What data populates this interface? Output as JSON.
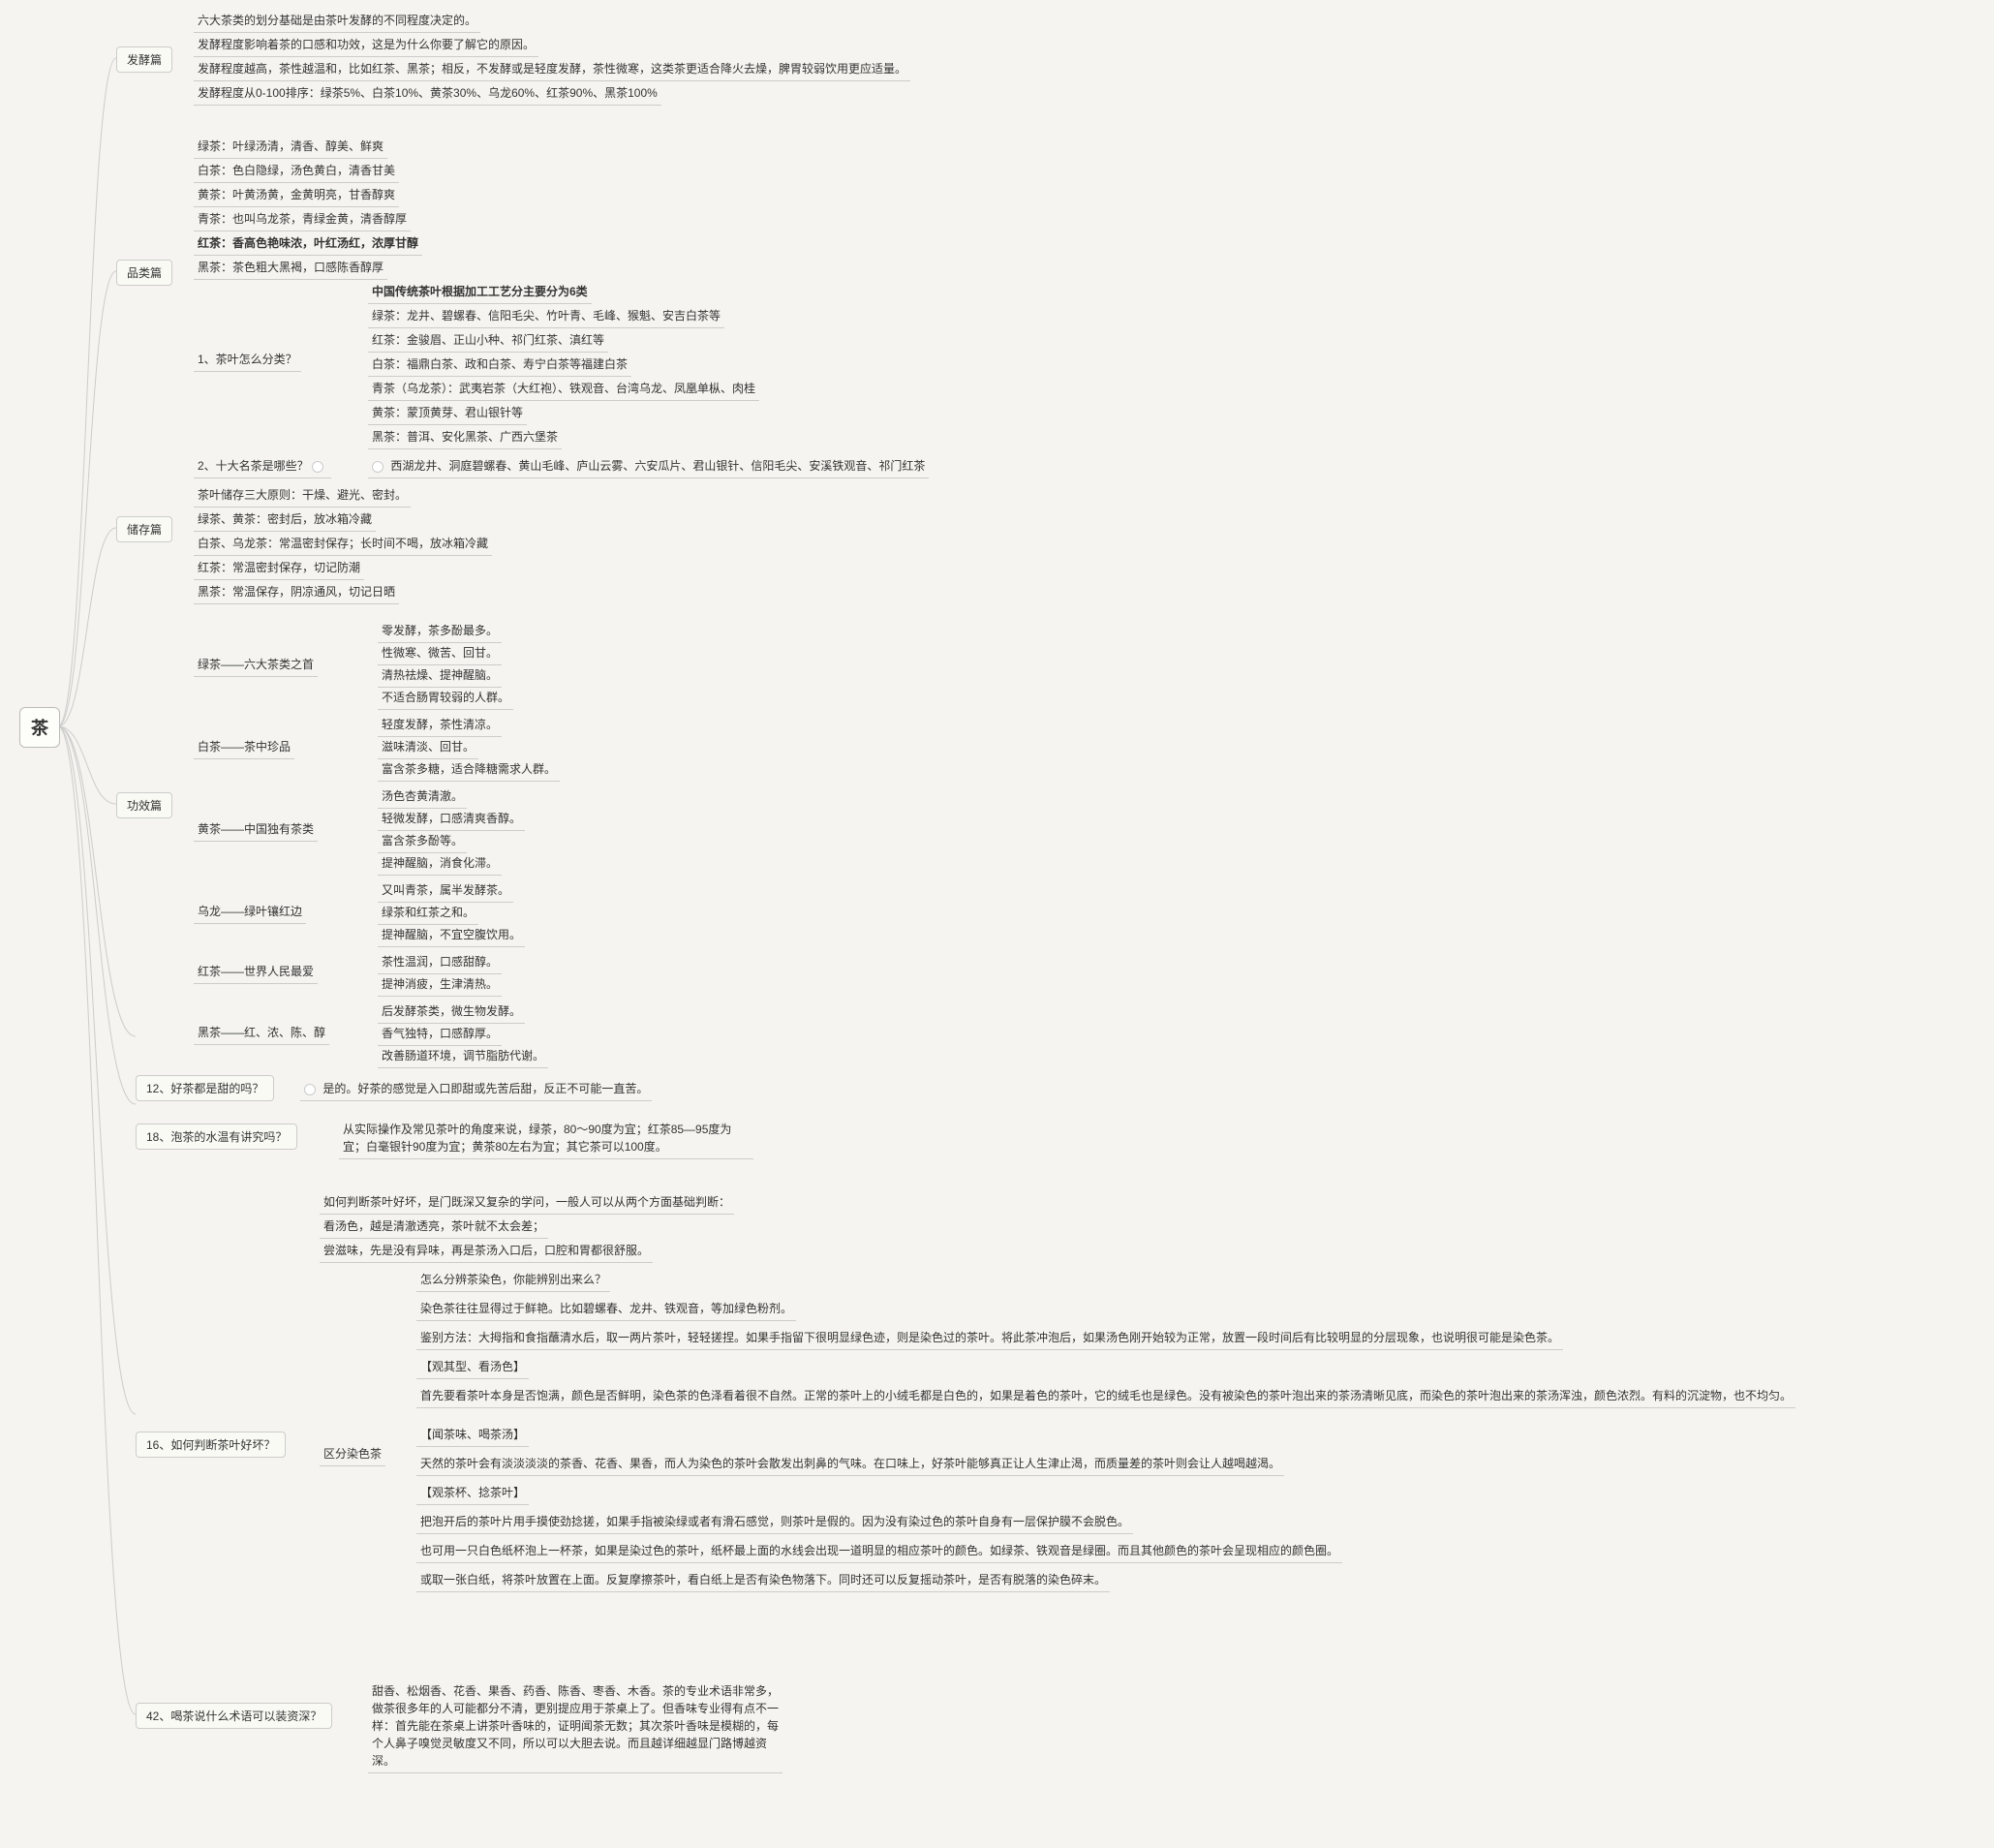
{
  "root": "茶",
  "fermentation": {
    "title": "发酵篇",
    "lines": [
      "六大茶类的划分基础是由茶叶发酵的不同程度决定的。",
      "发酵程度影响着茶的口感和功效，这是为什么你要了解它的原因。",
      "发酵程度越高，茶性越温和，比如红茶、黑茶；相反，不发酵或是轻度发酵，茶性微寒，这类茶更适合降火去燥，脾胃较弱饮用更应适量。",
      "发酵程度从0-100排序：绿茶5%、白茶10%、黄茶30%、乌龙60%、红茶90%、黑茶100%"
    ]
  },
  "category": {
    "title": "品类篇",
    "lines": [
      "绿茶：叶绿汤清，清香、醇美、鲜爽",
      "白茶：色白隐绿，汤色黄白，清香甘美",
      "黄茶：叶黄汤黄，金黄明亮，甘香醇爽",
      "青茶：也叫乌龙茶，青绿金黄，清香醇厚",
      "红茶：香高色艳味浓，叶红汤红，浓厚甘醇",
      "黑茶：茶色粗大黑褐，口感陈香醇厚"
    ],
    "q1": "1、茶叶怎么分类？",
    "q1_head": "中国传统茶叶根据加工工艺分主要分为6类",
    "q1_items": [
      "绿茶：龙井、碧螺春、信阳毛尖、竹叶青、毛峰、猴魁、安吉白茶等",
      "红茶：金骏眉、正山小种、祁门红茶、滇红等",
      "白茶：福鼎白茶、政和白茶、寿宁白茶等福建白茶",
      "青茶（乌龙茶）：武夷岩茶（大红袍）、铁观音、台湾乌龙、凤凰单枞、肉桂",
      "黄茶：蒙顶黄芽、君山银针等",
      "黑茶：普洱、安化黑茶、广西六堡茶"
    ],
    "q2": "2、十大名茶是哪些？",
    "q2_ans": "西湖龙井、洞庭碧螺春、黄山毛峰、庐山云雾、六安瓜片、君山银针、信阳毛尖、安溪铁观音、祁门红茶"
  },
  "storage": {
    "title": "储存篇",
    "lines": [
      "茶叶储存三大原则：干燥、避光、密封。",
      "绿茶、黄茶：密封后，放冰箱冷藏",
      "白茶、乌龙茶：常温密封保存；长时间不喝，放冰箱冷藏",
      "红茶：常温密封保存，切记防潮",
      "黑茶：常温保存，阴凉通风，切记日晒"
    ]
  },
  "effect": {
    "title": "功效篇",
    "teas": [
      {
        "name": "绿茶——六大茶类之首",
        "pts": [
          "零发酵，茶多酚最多。",
          "性微寒、微苦、回甘。",
          "清热祛燥、提神醒脑。",
          "不适合肠胃较弱的人群。"
        ]
      },
      {
        "name": "白茶——茶中珍品",
        "pts": [
          "轻度发酵，茶性清凉。",
          "滋味清淡、回甘。",
          "富含茶多糖，适合降糖需求人群。"
        ]
      },
      {
        "name": "黄茶——中国独有茶类",
        "pts": [
          "汤色杏黄清澈。",
          "轻微发酵，口感清爽香醇。",
          "富含茶多酚等。",
          "提神醒脑，消食化滞。"
        ]
      },
      {
        "name": "乌龙——绿叶镶红边",
        "pts": [
          "又叫青茶，属半发酵茶。",
          "绿茶和红茶之和。",
          "提神醒脑，不宜空腹饮用。"
        ]
      },
      {
        "name": "红茶——世界人民最爱",
        "pts": [
          "茶性温润，口感甜醇。",
          "提神消疲，生津清热。"
        ]
      },
      {
        "name": "黑茶——红、浓、陈、醇",
        "pts": [
          "后发酵茶类，微生物发酵。",
          "香气独特，口感醇厚。",
          "改善肠道环境，调节脂肪代谢。"
        ]
      }
    ]
  },
  "q12": {
    "q": "12、好茶都是甜的吗？",
    "a": "是的。好茶的感觉是入口即甜或先苦后甜，反正不可能一直苦。"
  },
  "q18": {
    "q": "18、泡茶的水温有讲究吗？",
    "a": "从实际操作及常见茶叶的角度来说，绿茶，80～90度为宜；红茶85—95度为宜；白毫银针90度为宜；黄茶80左右为宜；其它茶可以100度。"
  },
  "q16": {
    "q": "16、如何判断茶叶好坏？",
    "intro": [
      "如何判断茶叶好坏，是门既深又复杂的学问，一般人可以从两个方面基础判断：",
      "看汤色，越是清澈透亮，茶叶就不太会差；",
      "尝滋味，先是没有异味，再是茶汤入口后，口腔和胃都很舒服。"
    ],
    "dye_label": "区分染色茶",
    "dye": [
      "怎么分辨茶染色，你能辨别出来么？",
      "染色茶往往显得过于鲜艳。比如碧螺春、龙井、铁观音，等加绿色粉剂。",
      "鉴别方法：大拇指和食指蘸清水后，取一两片茶叶，轻轻搓捏。如果手指留下很明显绿色迹，则是染色过的茶叶。将此茶冲泡后，如果汤色刚开始较为正常，放置一段时间后有比较明显的分层现象，也说明很可能是染色茶。",
      "【观其型、看汤色】",
      "首先要看茶叶本身是否饱满，颜色是否鲜明，染色茶的色泽看着很不自然。正常的茶叶上的小绒毛都是白色的，如果是着色的茶叶，它的绒毛也是绿色。没有被染色的茶叶泡出来的茶汤清晰见底，而染色的茶叶泡出来的茶汤浑浊，颜色浓烈。有料的沉淀物，也不均匀。",
      "【闻茶味、喝茶汤】",
      "天然的茶叶会有淡淡淡淡的茶香、花香、果香，而人为染色的茶叶会散发出刺鼻的气味。在口味上，好茶叶能够真正让人生津止渴，而质量差的茶叶则会让人越喝越渴。",
      "【观茶杯、捻茶叶】",
      "把泡开后的茶叶片用手摸使劲捻搓，如果手指被染绿或者有滑石感觉，则茶叶是假的。因为没有染过色的茶叶自身有一层保护膜不会脱色。",
      "也可用一只白色纸杯泡上一杯茶，如果是染过色的茶叶，纸杯最上面的水线会出现一道明显的相应茶叶的颜色。如绿茶、铁观音是绿圈。而且其他颜色的茶叶会呈现相应的颜色圈。",
      "或取一张白纸，将茶叶放置在上面。反复摩擦茶叶，看白纸上是否有染色物落下。同时还可以反复摇动茶叶，是否有脱落的染色碎末。"
    ]
  },
  "q42": {
    "q": "42、喝茶说什么术语可以装资深？",
    "a": "甜香、松烟香、花香、果香、药香、陈香、枣香、木香。茶的专业术语非常多，做茶很多年的人可能都分不清，更别提应用于茶桌上了。但香味专业得有点不一样：首先能在茶桌上讲茶叶香味的，证明闻茶无数；其次茶叶香味是模糊的，每个人鼻子嗅觉灵敏度又不同，所以可以大胆去说。而且越详细越显门路博越资深。"
  }
}
